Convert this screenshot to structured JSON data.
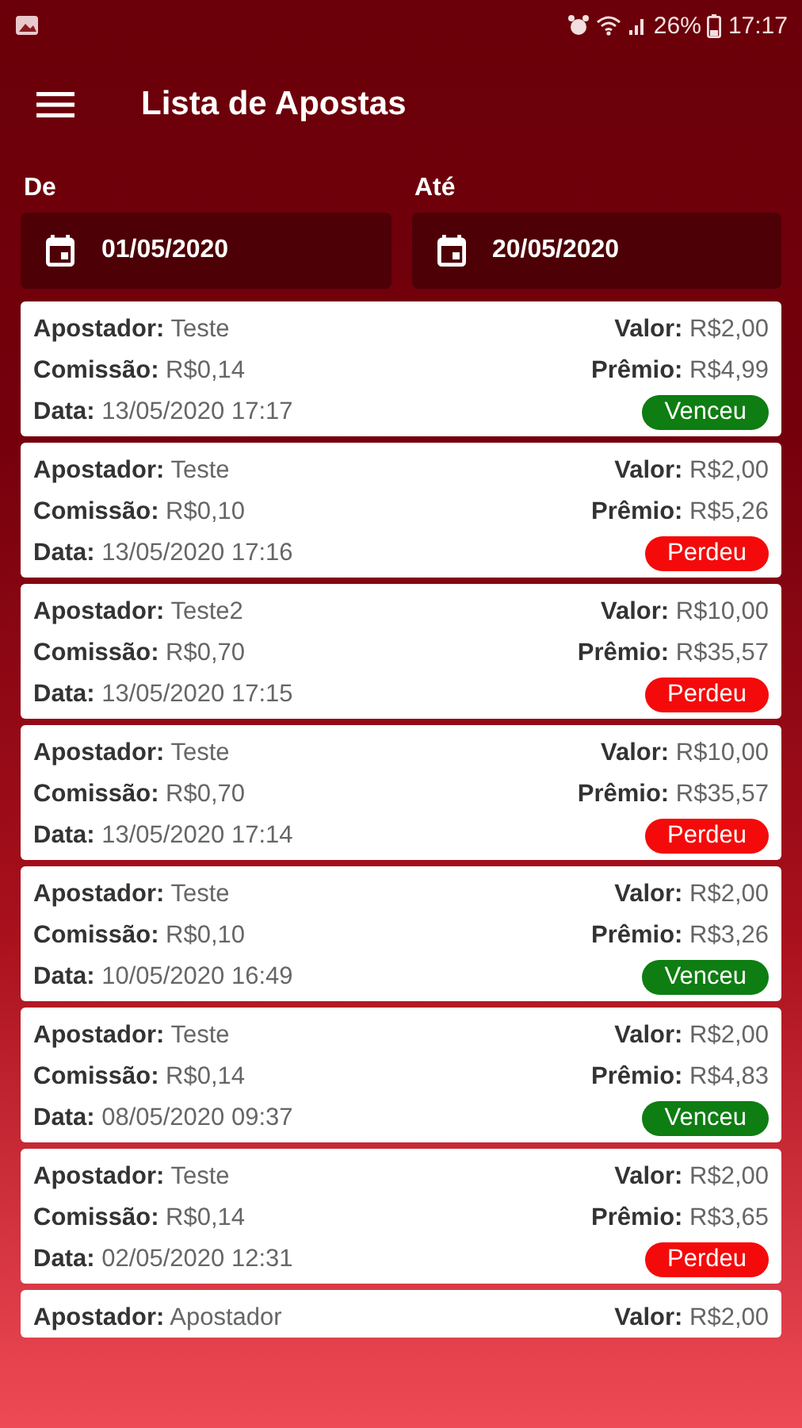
{
  "status_bar": {
    "battery": "26%",
    "time": "17:17"
  },
  "toolbar": {
    "title": "Lista de Apostas"
  },
  "filters": [
    {
      "label": "De",
      "value": "01/05/2020"
    },
    {
      "label": "Até",
      "value": "20/05/2020"
    }
  ],
  "bets": [
    {
      "bettor": "**Apostador:** Teste",
      "commission": "**Comissão:** R$0,14",
      "date": "**Data:** 13/05/2020 17:17",
      "amount": "**Valor:** R$2,00",
      "prize": "**Prêmio:** R$4,99",
      "result": {
        "label": "Venceu",
        "kind": "won"
      }
    },
    {
      "bettor": "**Apostador:** Teste",
      "commission": "**Comissão:** R$0,10",
      "date": "**Data:** 13/05/2020 17:16",
      "amount": "**Valor:** R$2,00",
      "prize": "**Prêmio:** R$5,26",
      "result": {
        "label": "Perdeu",
        "kind": "lost"
      }
    },
    {
      "bettor": "**Apostador:** Teste2",
      "commission": "**Comissão:** R$0,70",
      "date": "**Data:** 13/05/2020 17:15",
      "amount": "**Valor:** R$10,00",
      "prize": "**Prêmio:** R$35,57",
      "result": {
        "label": "Perdeu",
        "kind": "lost"
      }
    },
    {
      "bettor": "**Apostador:** Teste",
      "commission": "**Comissão:** R$0,70",
      "date": "**Data:** 13/05/2020 17:14",
      "amount": "**Valor:** R$10,00",
      "prize": "**Prêmio:** R$35,57",
      "result": {
        "label": "Perdeu",
        "kind": "lost"
      }
    },
    {
      "bettor": "**Apostador:** Teste",
      "commission": "**Comissão:** R$0,10",
      "date": "**Data:** 10/05/2020 16:49",
      "amount": "**Valor:** R$2,00",
      "prize": "**Prêmio:** R$3,26",
      "result": {
        "label": "Venceu",
        "kind": "won"
      }
    },
    {
      "bettor": "**Apostador:** Teste",
      "commission": "**Comissão:** R$0,14",
      "date": "**Data:** 08/05/2020 09:37",
      "amount": "**Valor:** R$2,00",
      "prize": "**Prêmio:** R$4,83",
      "result": {
        "label": "Venceu",
        "kind": "won"
      }
    },
    {
      "bettor": "**Apostador:** Teste",
      "commission": "**Comissão:** R$0,14",
      "date": "**Data:** 02/05/2020 12:31",
      "amount": "**Valor:** R$2,00",
      "prize": "**Prêmio:** R$3,65",
      "result": {
        "label": "Perdeu",
        "kind": "lost"
      }
    },
    {
      "bettor": "**Apostador:** Apostador",
      "amount": "**Valor:** R$2,00"
    }
  ]
}
